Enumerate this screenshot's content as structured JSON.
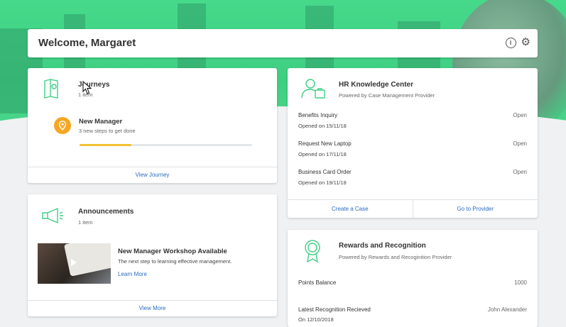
{
  "welcome": {
    "title": "Welcome, Margaret",
    "info_icon": "info-icon",
    "settings_icon": "gear-icon"
  },
  "journeys": {
    "title": "Journeys",
    "count": "1 item",
    "item": {
      "title": "New Manager",
      "subtitle": "3 new steps to get done",
      "progress": 0.3
    },
    "footer_link": "View Journey"
  },
  "announcements": {
    "title": "Announcements",
    "count": "1 item",
    "item": {
      "title": "New Manager Workshop Available",
      "description": "The next step to learning effective management.",
      "link": "Learn More"
    },
    "footer_link": "View More"
  },
  "hr": {
    "title": "HR Knowledge Center",
    "subtitle": "Powered by Case Management Provider",
    "cases": [
      {
        "name": "Benefits Inquiry",
        "status": "Open",
        "opened": "Opened on 15/11/18"
      },
      {
        "name": "Request New Laptop",
        "status": "Open",
        "opened": "Opened on 17/11/18"
      },
      {
        "name": "Business Card Order",
        "status": "Open",
        "opened": "Opened on 19/11/18"
      }
    ],
    "footer_left": "Create a Case",
    "footer_right": "Go to Provider"
  },
  "rewards": {
    "title": "Rewards and Recognition",
    "subtitle": "Powered by Rewards and Recoginition Provider",
    "points_label": "Points Balance",
    "points_value": "1000",
    "recognition_label": "Latest Recognition Recieved",
    "recognition_from": "John Alexander",
    "recognition_date": "On 12/10/2018"
  },
  "colors": {
    "accent_green": "#3fcf83",
    "link_blue": "#2a6bc0",
    "progress_yellow": "#f2c230",
    "badge_orange": "#f5a623"
  }
}
